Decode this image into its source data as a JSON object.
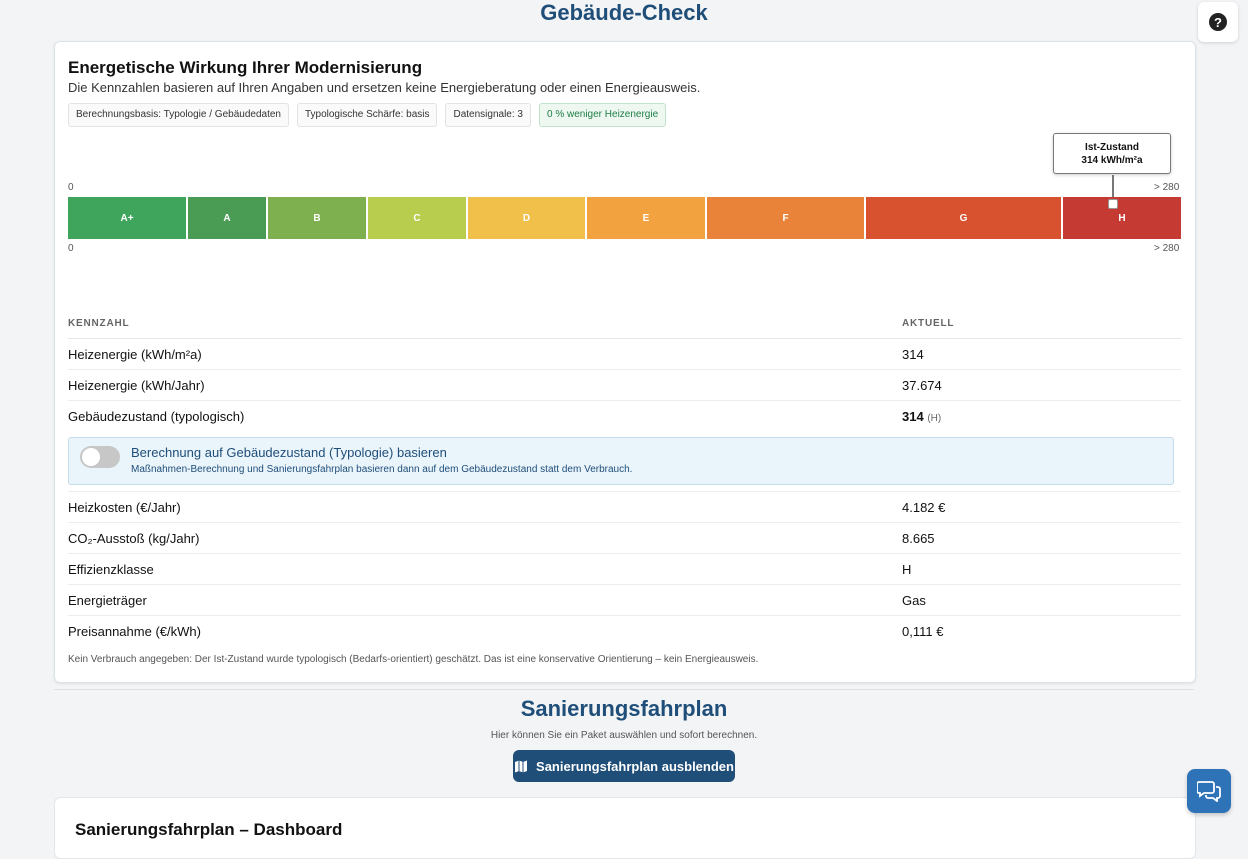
{
  "page": {
    "title": "Gebäude-Check"
  },
  "help": {
    "icon": "question-icon",
    "glyph": "?"
  },
  "card": {
    "title": "Energetische Wirkung Ihrer Modernisierung",
    "subtitle": "Die Kennzahlen basieren auf Ihren Angaben und ersetzen keine Energieberatung oder einen Energieausweis.",
    "chips": [
      "Berechnungsbasis: Typologie / Gebäudedaten",
      "Typologische Schärfe: basis",
      "Datensignale: 3",
      "0 % weniger Heizenergie"
    ]
  },
  "scale": {
    "min_label": "0",
    "max_label": "> 280",
    "marker_title": "Ist-Zustand",
    "marker_value": "314 kWh/m²a",
    "marker_class": "H",
    "classes": [
      {
        "label": "A+",
        "color": "#3fa55d"
      },
      {
        "label": "A",
        "color": "#4a9c54"
      },
      {
        "label": "B",
        "color": "#7fb04f"
      },
      {
        "label": "C",
        "color": "#b8cc4e"
      },
      {
        "label": "D",
        "color": "#f1c04b"
      },
      {
        "label": "E",
        "color": "#f2a340"
      },
      {
        "label": "F",
        "color": "#e9833a"
      },
      {
        "label": "G",
        "color": "#d9522f"
      },
      {
        "label": "H",
        "color": "#c53b34"
      }
    ]
  },
  "table": {
    "col_key": "KENNZAHL",
    "col_value": "AKTUELL",
    "rows_top": [
      {
        "key": "Heizenergie (kWh/m²a)",
        "value": "314"
      },
      {
        "key": "Heizenergie (kWh/Jahr)",
        "value": "37.674"
      },
      {
        "key": "Gebäudezustand (typologisch)",
        "value": "314",
        "suffix": "(H)"
      }
    ],
    "toggle": {
      "title": "Berechnung auf Gebäudezustand (Typologie) basieren",
      "subtitle": "Maßnahmen-Berechnung und Sanierungsfahrplan basieren dann auf dem Gebäudezustand statt dem Verbrauch.",
      "checked": false
    },
    "rows_bottom": [
      {
        "key": "Heizkosten (€/Jahr)",
        "value": "4.182 €"
      },
      {
        "key": "CO₂-Ausstoß (kg/Jahr)",
        "value": "8.665"
      },
      {
        "key": "Effizienzklasse",
        "value": "H"
      },
      {
        "key": "Energieträger",
        "value": "Gas"
      },
      {
        "key": "Preisannahme (€/kWh)",
        "value": "0,111 €"
      }
    ],
    "note": "Kein Verbrauch angegeben: Der Ist-Zustand wurde typologisch (Bedarfs-orientiert) geschätzt. Das ist eine konservative Orientierung – kein Energieausweis."
  },
  "plan": {
    "title": "Sanierungsfahrplan",
    "subtitle": "Hier können Sie ein Paket auswählen und sofort berechnen.",
    "button_label": "Sanierungsfahrplan ausblenden",
    "dashboard_title": "Sanierungsfahrplan – Dashboard"
  }
}
